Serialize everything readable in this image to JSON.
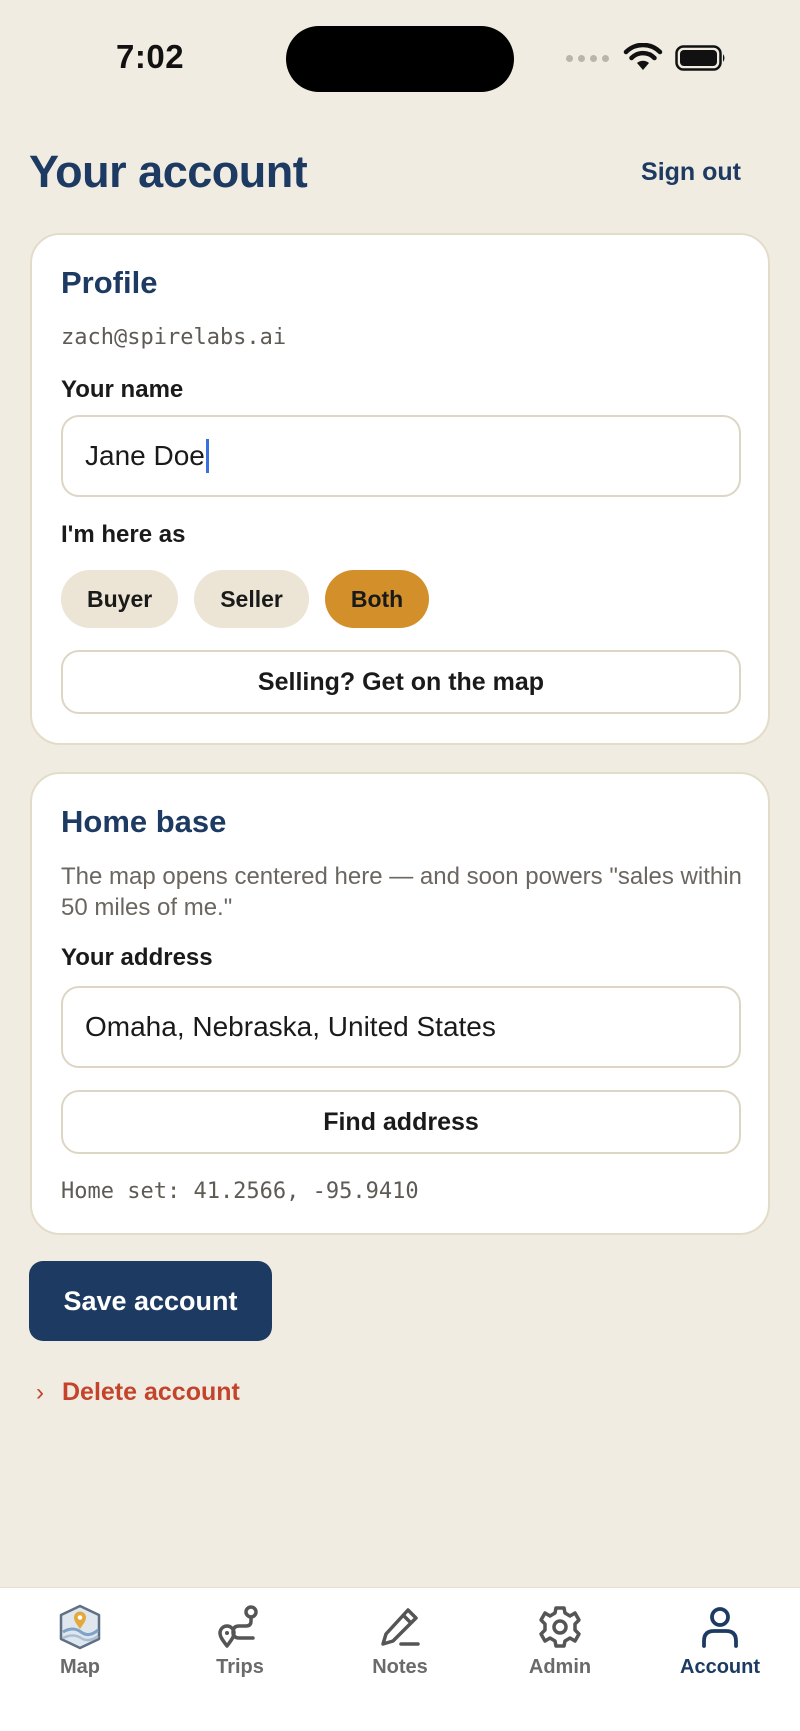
{
  "status_bar": {
    "time": "7:02",
    "icons": [
      "signal-dots-icon",
      "wifi-icon",
      "battery-icon"
    ]
  },
  "header": {
    "title": "Your account",
    "sign_out_label": "Sign out"
  },
  "profile": {
    "title": "Profile",
    "email": "zach@spirelabs.ai",
    "name_label": "Your name",
    "name_value": "Jane Doe",
    "role_label": "I'm here as",
    "roles": [
      "Buyer",
      "Seller",
      "Both"
    ],
    "selected_role": "Both",
    "seller_cta": "Selling? Get on the map"
  },
  "home_base": {
    "title": "Home base",
    "description": "The map opens centered here — and soon powers \"sales within 50 miles of me.\"",
    "address_label": "Your address",
    "address_value": "Omaha, Nebraska, United States",
    "find_button": "Find address",
    "home_set": "Home set: 41.2566, -95.9410"
  },
  "actions": {
    "save_label": "Save account",
    "delete_label": "Delete account"
  },
  "tab_bar": {
    "tabs": [
      {
        "label": "Map",
        "icon": "map-icon"
      },
      {
        "label": "Trips",
        "icon": "route-icon"
      },
      {
        "label": "Notes",
        "icon": "pencil-icon"
      },
      {
        "label": "Admin",
        "icon": "gear-icon"
      },
      {
        "label": "Account",
        "icon": "person-icon"
      }
    ],
    "active": "Account"
  },
  "colors": {
    "background": "#f1ece2",
    "navy": "#1d3b62",
    "accent": "#d38f2a",
    "danger": "#c4442b"
  }
}
